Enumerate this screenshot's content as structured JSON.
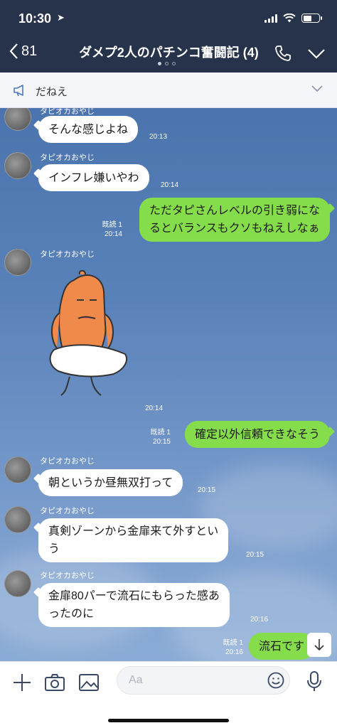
{
  "status": {
    "time": "10:30",
    "location_glyph": "➤"
  },
  "header": {
    "back_count": "81",
    "title": "ダメプ2人のパチンコ奮闘記 (4)"
  },
  "announcement": {
    "text": "だねえ"
  },
  "messages": [
    {
      "side": "in",
      "sender": "タピオカおやじ",
      "text": "そんな感じよね",
      "time": "20:13"
    },
    {
      "side": "in",
      "sender": "タピオカおやじ",
      "text": "インフレ嫌いやわ",
      "time": "20:14"
    },
    {
      "side": "out",
      "read": "既読 1",
      "text": "ただタピさんレベルの引き弱にな\nるとバランスもクソもねえしなぁ",
      "time": "20:14"
    },
    {
      "side": "in",
      "sender": "タピオカおやじ",
      "type": "sticker",
      "time": "20:14"
    },
    {
      "side": "out",
      "read": "既読 1",
      "text": "確定以外信頼できなそう",
      "time": "20:15"
    },
    {
      "side": "in",
      "sender": "タピオカおやじ",
      "text": "朝というか昼無双打って",
      "time": "20:15"
    },
    {
      "side": "in",
      "sender": "タピオカおやじ",
      "text": "真剣ゾーンから金扉来て外すとい\nう",
      "time": "20:15"
    },
    {
      "side": "in",
      "sender": "タピオカおやじ",
      "text": "金扉80パーで流石にもらった感あ\nったのに",
      "time": "20:16"
    },
    {
      "side": "out",
      "read": "既読 1",
      "text": "流石です",
      "time": "20:16"
    }
  ],
  "input": {
    "placeholder": "Aa"
  },
  "icons": {
    "back": "chevron-left-icon",
    "call": "phone-icon",
    "menu": "chevron-down-icon",
    "announce": "megaphone-icon",
    "plus": "plus-icon",
    "camera": "camera-icon",
    "image": "image-icon",
    "emoji": "emoji-icon",
    "mic": "microphone-icon",
    "scroll": "arrow-down-icon"
  },
  "colors": {
    "header_bg": "#27334a",
    "outgoing_bubble": "#86dd4b",
    "incoming_bubble": "#ffffff"
  }
}
